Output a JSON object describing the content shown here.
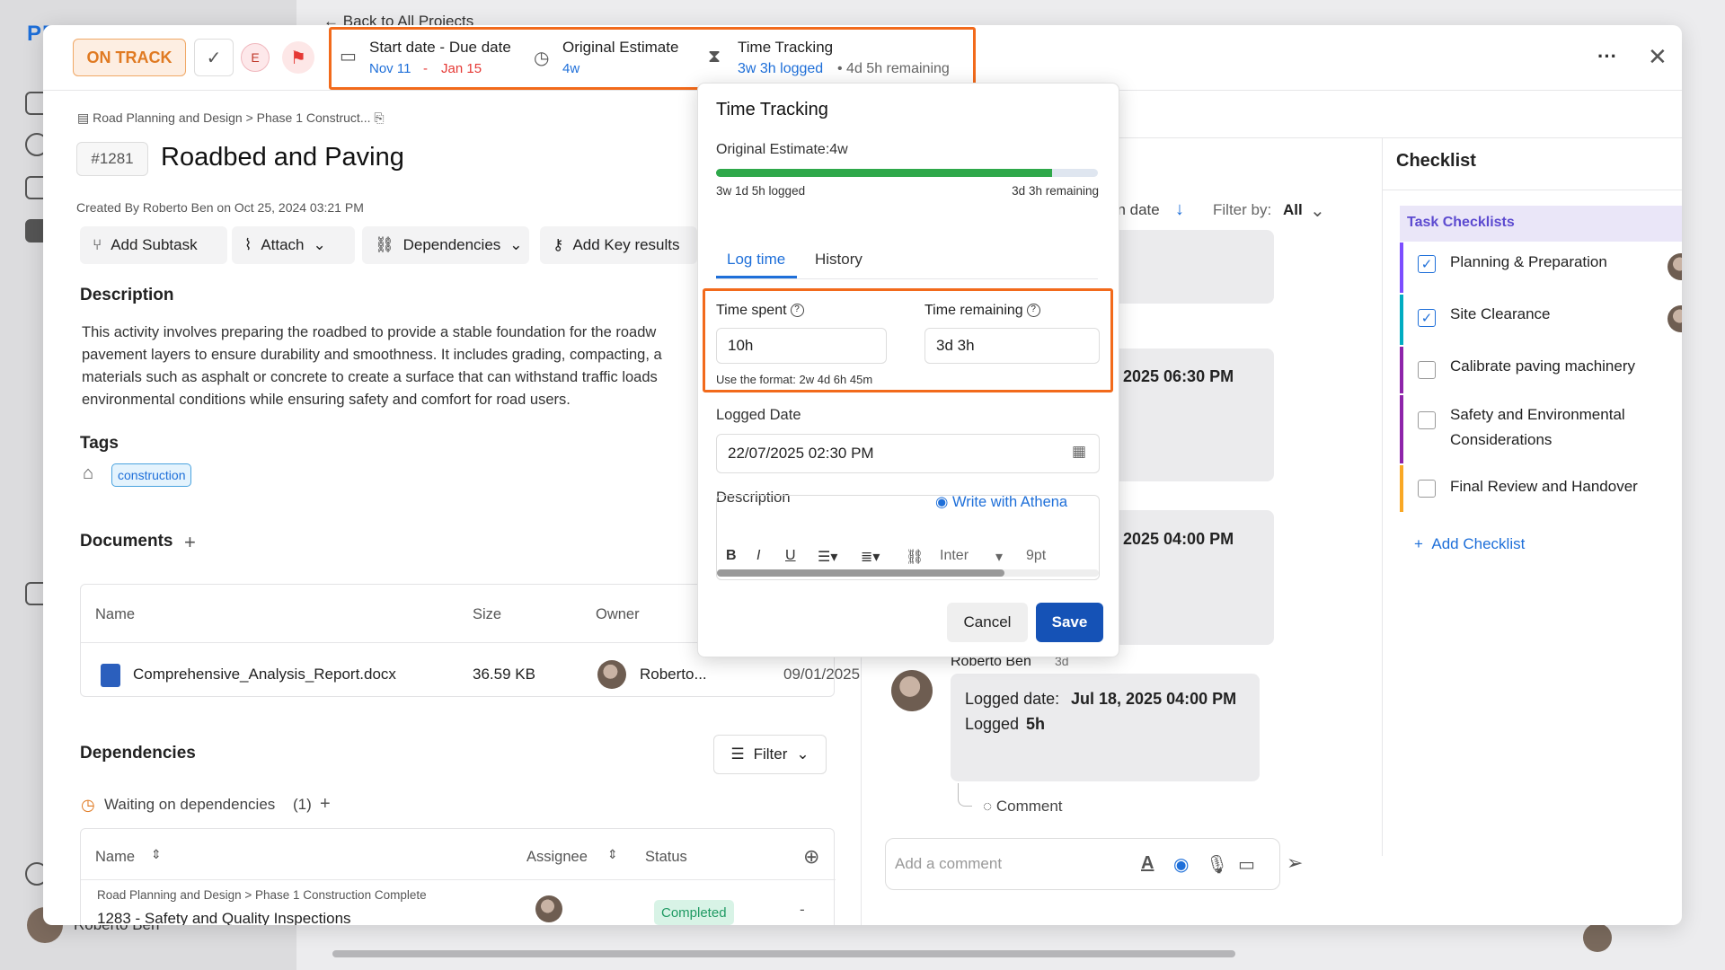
{
  "background": {
    "logo": "PR",
    "back_link": "Back to All Projects",
    "user_name": "Roberto Ben"
  },
  "modal": {
    "status_label": "ON TRACK",
    "assignee_initial": "E",
    "dates": {
      "label": "Start date - Due date",
      "start": "Nov 11",
      "separator": "-",
      "due": "Jan 15"
    },
    "estimate": {
      "label": "Original Estimate",
      "value": "4w"
    },
    "tracking": {
      "label": "Time Tracking",
      "logged": "3w 3h logged",
      "remaining": "• 4d 5h remaining"
    },
    "breadcrumb": "Road Planning and Design > Phase 1 Construct...",
    "task_id": "#1281",
    "title": "Roadbed and Paving",
    "created": "Created By Roberto Ben on Oct 25, 2024 03:21 PM",
    "toolbar": {
      "add_subtask": "Add Subtask",
      "attach": "Attach",
      "dependencies": "Dependencies",
      "key_results": "Add Key results"
    },
    "description_title": "Description",
    "description": "This activity involves preparing the roadbed to provide a stable foundation for the roadw\npavement layers to ensure durability and smoothness. It includes grading, compacting, a\nmaterials such as asphalt or concrete to create a surface that can withstand traffic loads\nenvironmental conditions while ensuring safety and comfort for road users.",
    "tags_title": "Tags",
    "tags": [
      "construction"
    ],
    "documents_title": "Documents",
    "documents": {
      "headers": [
        "Name",
        "Size",
        "Owner"
      ],
      "rows": [
        {
          "name": "Comprehensive_Analysis_Report.docx",
          "size": "36.59 KB",
          "owner": "Roberto...",
          "date": "09/01/2025"
        }
      ]
    },
    "dependencies_title": "Dependencies",
    "filter_label": "Filter",
    "waiting_label": "Waiting on dependencies",
    "waiting_count": "(1)",
    "dep_table": {
      "headers": [
        "Name",
        "Assignee",
        "Status"
      ],
      "rows": [
        {
          "path": "Road Planning and Design > Phase 1 Construction Complete",
          "name": "1283 - Safety and Quality Inspections",
          "status": "Completed",
          "extra": "-"
        }
      ]
    }
  },
  "activity": {
    "sort_label": "on date",
    "filter_by": "Filter by:",
    "filter_value": "All",
    "entry1_date": "2025 06:30 PM",
    "entry2_date": "2025 04:00 PM",
    "entry3_author": "Roberto Ben",
    "entry3_ago": "3d",
    "entry3_logged_date_label": "Logged date:",
    "entry3_logged_date": "Jul 18, 2025 04:00 PM",
    "entry3_logged_label": "Logged",
    "entry3_logged": "5h",
    "comment_link": "Comment",
    "comment_placeholder": "Add a comment"
  },
  "checklist": {
    "title": "Checklist",
    "group": "Task Checklists",
    "items": [
      {
        "label": "Planning & Preparation",
        "checked": true,
        "color": "#7c4dff"
      },
      {
        "label": "Site Clearance",
        "checked": true,
        "color": "#00acc1"
      },
      {
        "label": "Calibrate paving machinery",
        "checked": false,
        "color": "#8e24aa"
      },
      {
        "label": "Safety and Environmental Considerations",
        "checked": false,
        "color": "#8e24aa"
      },
      {
        "label": "Final Review and Handover",
        "checked": false,
        "color": "#f9a825"
      }
    ],
    "add_label": "Add Checklist"
  },
  "popover": {
    "title": "Time Tracking",
    "estimate": "Original Estimate:4w",
    "progress": 0.88,
    "logged": "3w 1d 5h logged",
    "remaining": "3d 3h remaining",
    "tabs": [
      "Log time",
      "History"
    ],
    "time_spent_label": "Time spent",
    "time_spent_value": "10h",
    "time_remaining_label": "Time remaining",
    "time_remaining_value": "3d 3h",
    "format_hint": "Use the format: 2w 4d 6h 45m",
    "logged_date_label": "Logged Date",
    "logged_date_value": "22/07/2025 02:30 PM",
    "description_label": "Description",
    "athena_label": "Write with Athena",
    "font_name": "Inter",
    "font_size": "9pt",
    "cancel": "Cancel",
    "save": "Save"
  },
  "colors": {
    "accent": "#1e6fd9",
    "highlight": "#f26a1b",
    "save": "#1552b6",
    "status": "#e07a22"
  }
}
